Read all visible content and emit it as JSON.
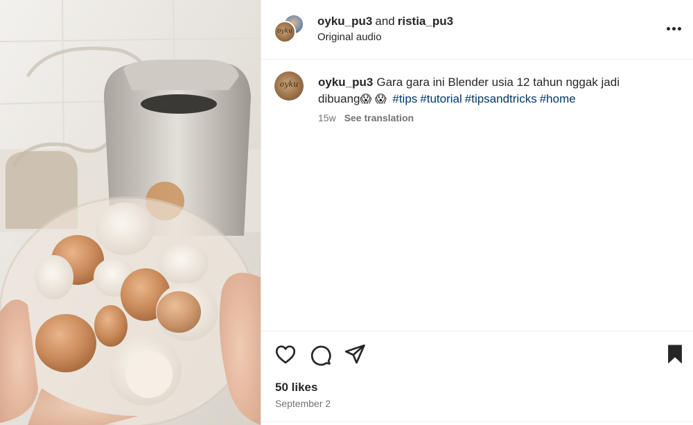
{
  "post": {
    "media": {
      "description_icon": "photo",
      "subject": "glass-bowl-of-eggshells"
    },
    "header": {
      "user1": "oyku_pu3",
      "connector": "and",
      "user2": "ristia_pu3",
      "audio": "Original audio",
      "avatar_text": "oyku",
      "more_icon": "more-horizontal-icon"
    },
    "caption": {
      "username": "oyku_pu3",
      "text_part1": "Gara gara ini Blender usia 12 tahun nggak jadi dibuang",
      "emoji1": "😱",
      "emoji2": "😱",
      "hashtags": [
        "#tips",
        "#tutorial",
        "#tipsandtricks",
        "#home"
      ],
      "age": "15w",
      "translation_label": "See translation"
    },
    "actions": {
      "like_icon": "heart-icon",
      "comment_icon": "comment-icon",
      "share_icon": "send-icon",
      "save_icon": "bookmark-icon"
    },
    "likes": "50 likes",
    "date": "September 2"
  }
}
